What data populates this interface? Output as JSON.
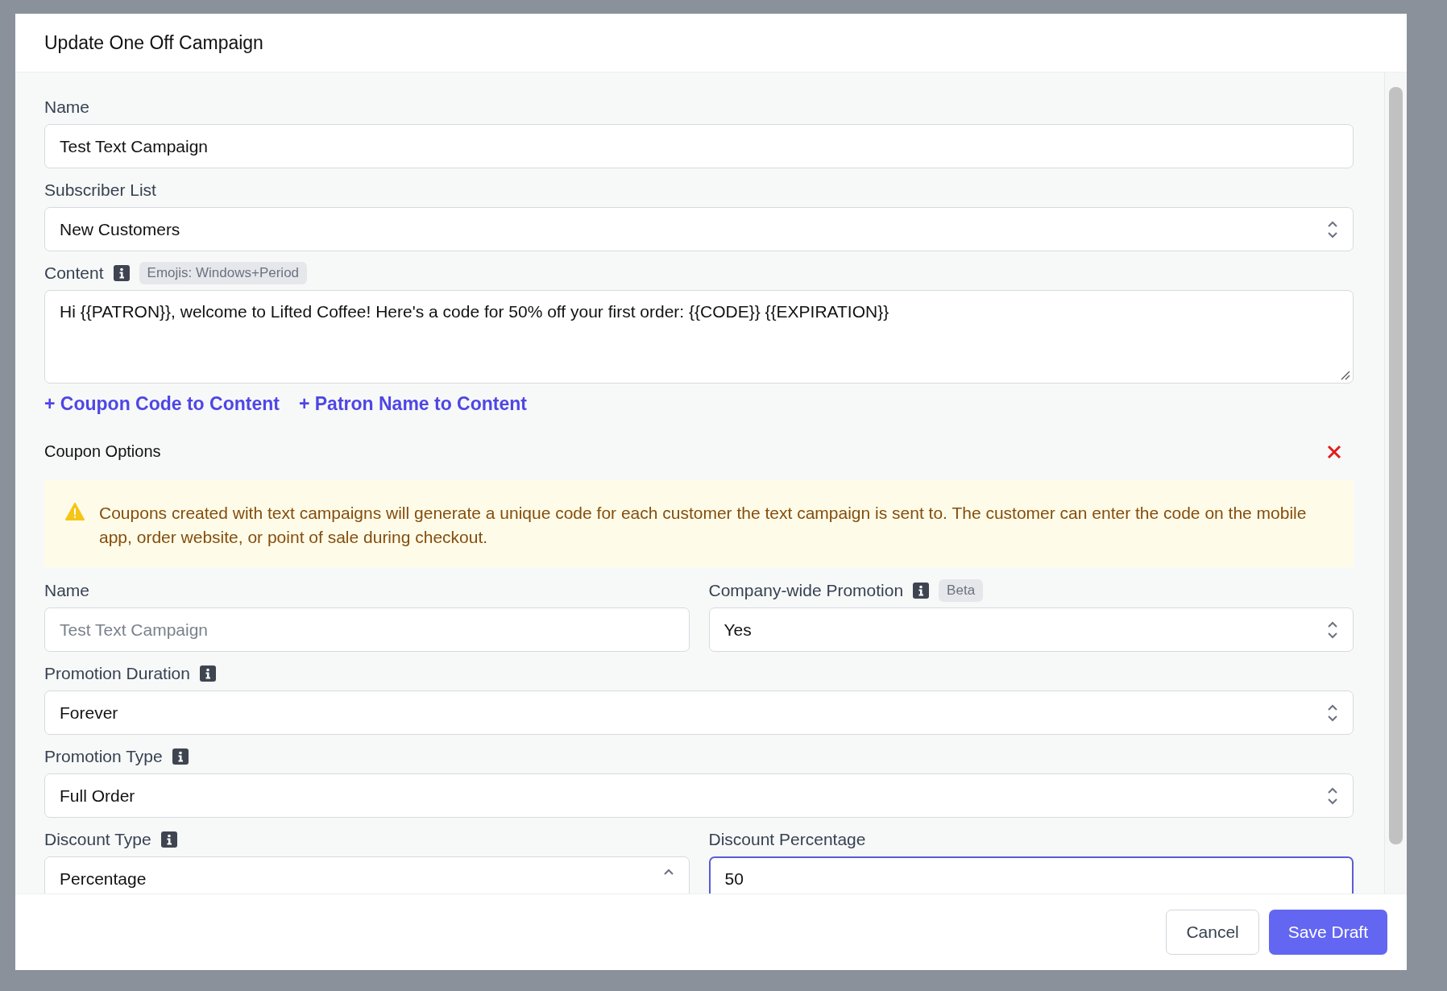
{
  "dialog": {
    "title": "Update One Off Campaign"
  },
  "fields": [
    {
      "label": "Name",
      "kind": "text",
      "value": "Test Text Campaign"
    },
    {
      "label": "Subscriber List",
      "kind": "select",
      "value": "New Customers"
    },
    {
      "label": "Content",
      "kind": "textarea",
      "info": true,
      "badge": "Emojis: Windows+Period",
      "value": "Hi {{PATRON}}, welcome to Lifted Coffee! Here's a code for 50% off your first order: {{CODE}} {{EXPIRATION}}"
    }
  ],
  "insert_links": [
    "+ Coupon Code to Content",
    "+ Patron Name to Content"
  ],
  "coupon_options": {
    "title": "Coupon Options",
    "notice": "Coupons created with text campaigns will generate a unique code for each customer the text campaign is sent to. The customer can enter the code on the mobile app, order website, or point of sale during checkout.",
    "rows": [
      [
        {
          "label": "Name",
          "kind": "text",
          "placeholder": "Test Text Campaign"
        },
        {
          "label": "Company-wide Promotion",
          "kind": "select",
          "info": true,
          "badge": "Beta",
          "value": "Yes"
        }
      ],
      [
        {
          "label": "Promotion Duration",
          "kind": "select",
          "info": true,
          "value": "Forever"
        }
      ],
      [
        {
          "label": "Promotion Type",
          "kind": "select",
          "info": true,
          "value": "Full Order"
        }
      ],
      [
        {
          "label": "Discount Type",
          "kind": "select",
          "info": true,
          "expanded": true,
          "value": "Percentage"
        },
        {
          "label": "Discount Percentage",
          "kind": "text",
          "focused": true,
          "value": "50"
        }
      ]
    ]
  },
  "buttons": [
    {
      "label": "Cancel",
      "kind": "secondary"
    },
    {
      "label": "Save Draft",
      "kind": "primary"
    }
  ]
}
